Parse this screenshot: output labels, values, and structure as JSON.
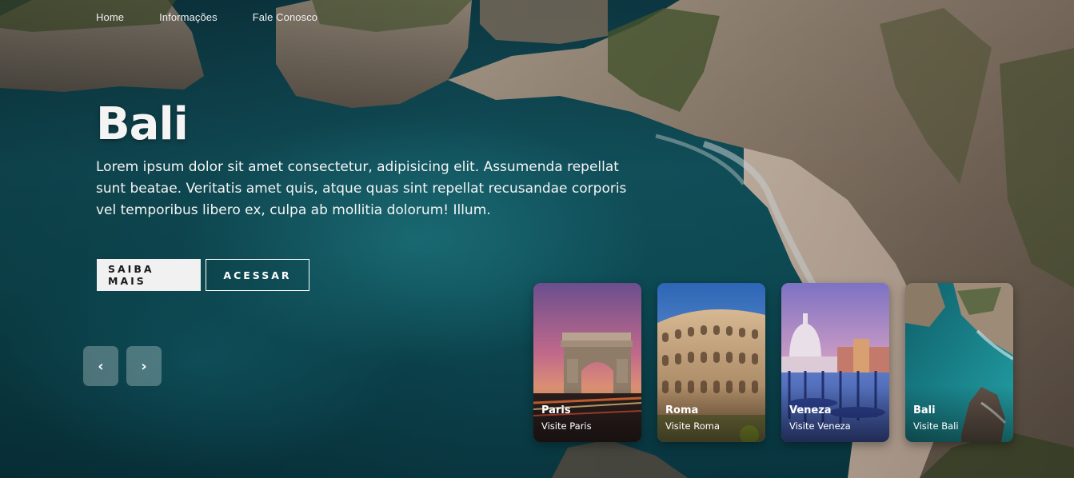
{
  "nav": {
    "items": [
      "Home",
      "Informações",
      "Fale Conosco"
    ]
  },
  "hero": {
    "title": "Bali",
    "description": "Lorem ipsum dolor sit amet consectetur, adipisicing elit. Assumenda repellat sunt beatae. Veritatis amet quis, atque quas sint repellat recusandae corporis vel temporibus libero ex, culpa ab mollitia dolorum! Illum.",
    "primary_button": "SAIBA MAIS",
    "secondary_button": "ACESSAR"
  },
  "slider": {
    "prev_icon": "chevron-left-icon",
    "prev_label": "‹",
    "next_icon": "chevron-right-icon",
    "next_label": "›"
  },
  "cards": [
    {
      "title": "Paris",
      "subtitle": "Visite Paris"
    },
    {
      "title": "Roma",
      "subtitle": "Visite Roma"
    },
    {
      "title": "Veneza",
      "subtitle": "Visite Veneza"
    },
    {
      "title": "Bali",
      "subtitle": "Visite Bali"
    }
  ],
  "colors": {
    "sea": "#135a66",
    "cliff": "#9a8a78",
    "button_light": "#f1f1f1",
    "text": "#ffffff"
  }
}
